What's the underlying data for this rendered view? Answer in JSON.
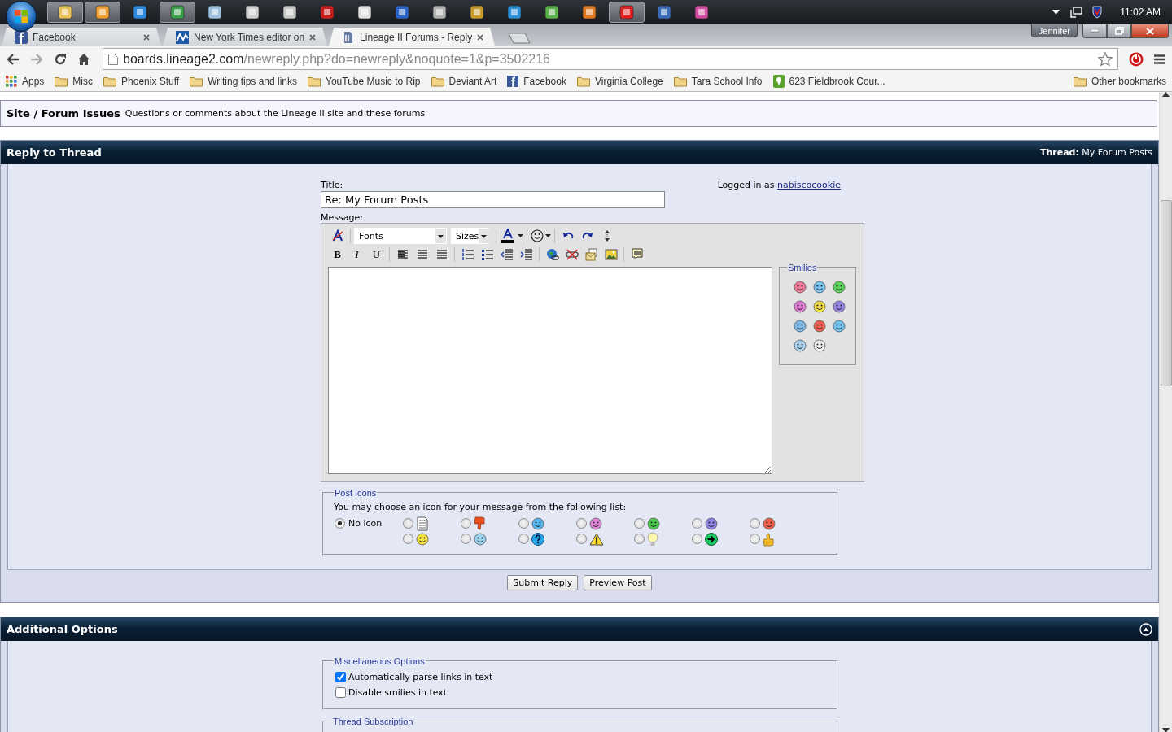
{
  "taskbar": {
    "apps": [
      {
        "color": "#e8c25a",
        "selected": true
      },
      {
        "color": "#f0a030",
        "selected": true
      },
      {
        "color": "#2a8ae0",
        "selected": false
      },
      {
        "color": "#3aa04a",
        "selected": true
      },
      {
        "color": "#9cc0e0",
        "selected": false
      },
      {
        "color": "#d0d0d0",
        "selected": false
      },
      {
        "color": "#c8c8c8",
        "selected": false
      },
      {
        "color": "#c81e1e",
        "selected": false
      },
      {
        "color": "#e0e0e0",
        "selected": false
      },
      {
        "color": "#2a64c8",
        "selected": false
      },
      {
        "color": "#b0b0b0",
        "selected": false
      },
      {
        "color": "#c89a2a",
        "selected": false
      },
      {
        "color": "#2a90d8",
        "selected": false
      },
      {
        "color": "#5ab04a",
        "selected": false
      },
      {
        "color": "#e07820",
        "selected": false
      },
      {
        "color": "#e02020",
        "selected": true
      },
      {
        "color": "#3a6ab8",
        "selected": false
      },
      {
        "color": "#d04aa0",
        "selected": false
      }
    ],
    "clock": "11:02 AM"
  },
  "browser": {
    "tabs": [
      {
        "title": "Facebook",
        "kind": "square",
        "color": "#3b5998",
        "selected": false
      },
      {
        "title": "New York Times editor on",
        "kind": "chart",
        "color": "#1f5aa8",
        "selected": false
      },
      {
        "title": "Lineage II Forums - Reply",
        "kind": "page",
        "color": "#6a7ea8",
        "selected": true
      }
    ],
    "profile": "Jennifer",
    "address": {
      "host": "boards.lineage2.com",
      "path": "/newreply.php?do=newreply&noquote=1&p=3502216"
    },
    "bookmarks": [
      {
        "label": "Apps",
        "kind": "apps"
      },
      {
        "label": "Misc",
        "kind": "folder"
      },
      {
        "label": "Phoenix Stuff",
        "kind": "folder"
      },
      {
        "label": "Writing tips and links",
        "kind": "folder"
      },
      {
        "label": "YouTube Music to Rip",
        "kind": "folder"
      },
      {
        "label": "Deviant Art",
        "kind": "folder"
      },
      {
        "label": "Facebook",
        "kind": "site"
      },
      {
        "label": "Virginia College",
        "kind": "folder"
      },
      {
        "label": "Tara School Info",
        "kind": "folder"
      },
      {
        "label": "623 Fieldbrook Cour...",
        "kind": "place"
      }
    ],
    "other_bookmarks": "Other bookmarks"
  },
  "forum": {
    "breadcrumb": {
      "title": "Site / Forum Issues",
      "description": "Questions or comments about the Lineage II site and these forums"
    },
    "reply_panel": {
      "heading": "Reply to Thread",
      "thread_info": "**Thread:** My Forum Posts",
      "title_label": "Title:",
      "title_value": "Re: My Forum Posts",
      "login_text": "Logged in as",
      "username": "nabiscocookie",
      "message_label": "Message:",
      "editor": {
        "font_select": "Fonts",
        "size_select": "Sizes",
        "format_buttons": [
          {
            "label": "B",
            "kind": "bold"
          },
          {
            "label": "I",
            "kind": "italic"
          },
          {
            "label": "U",
            "kind": "underline"
          }
        ],
        "smilies_legend": "Smilies",
        "smilies": [
          {
            "color": "#f07a98"
          },
          {
            "color": "#78c4f0"
          },
          {
            "color": "#5ad35a"
          },
          {
            "color": "#e47ad8"
          },
          {
            "color": "#f5e142"
          },
          {
            "color": "#9a86e8"
          },
          {
            "color": "#7ab8ea"
          },
          {
            "color": "#f06050"
          },
          {
            "color": "#6fc2f0"
          },
          {
            "color": "#a8d4f0"
          },
          {
            "color": "#f4f4f4"
          }
        ]
      },
      "post_icons": {
        "legend": "Post Icons",
        "prompt": "You may choose an icon for your message from the following list:",
        "none_option": {
          "label": "No icon",
          "selected": true
        },
        "options": [
          {
            "kind": "document",
            "selected": false
          },
          {
            "kind": "thumbs-down",
            "selected": false
          },
          {
            "kind": "face",
            "color": "#56b8f0",
            "selected": false
          },
          {
            "kind": "face",
            "color": "#e283d8",
            "selected": false
          },
          {
            "kind": "face",
            "color": "#4ccc4c",
            "selected": false
          },
          {
            "kind": "face",
            "color": "#8e84e6",
            "selected": false
          },
          {
            "kind": "face",
            "color": "#f0604a",
            "selected": false
          },
          {
            "kind": "face",
            "color": "#f5e142",
            "selected": false
          },
          {
            "kind": "face",
            "color": "#9ad0f0",
            "selected": false
          },
          {
            "kind": "question",
            "selected": false
          },
          {
            "kind": "warning",
            "selected": false
          },
          {
            "kind": "lightbulb",
            "selected": false
          },
          {
            "kind": "arrow",
            "selected": false
          },
          {
            "kind": "thumbs-up",
            "selected": false
          }
        ]
      },
      "buttons": [
        "Submit Reply",
        "Preview Post"
      ]
    },
    "additional_options": {
      "heading": "Additional Options",
      "expanded": true,
      "misc_legend": "Miscellaneous Options",
      "checkboxes": [
        {
          "label": "Automatically parse links in text",
          "checked": true
        },
        {
          "label": "Disable smilies in text",
          "checked": false
        }
      ],
      "subscription_legend": "Thread Subscription"
    }
  }
}
